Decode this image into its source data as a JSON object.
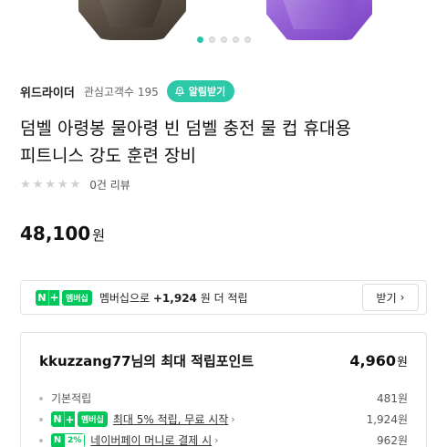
{
  "carousel": {
    "slide_count": 5,
    "active_index": 0
  },
  "seller": {
    "name": "위드라이더",
    "fans_label": "관심고객수 195",
    "alarm_button": "알림받기"
  },
  "product": {
    "title_line1": "덤벨 아령봉 물아령 빈 덤벨 충전 물 컵 휴대용",
    "title_line2": "피트니스 강도 훈련 장비",
    "rating_stars": 0,
    "review_count": "0건 리뷰",
    "price": "48,100",
    "price_unit": "원"
  },
  "membership": {
    "badge_n": "N",
    "badge_plus": "+",
    "badge_label": "멤버십",
    "text_prefix": "멤버십으로",
    "amount": "+1,924",
    "text_suffix": "원 더 적립",
    "receive_button": "받기"
  },
  "points": {
    "title": "kkuzzang77님의 최대 적립포인트",
    "total": "4,960",
    "total_unit": "원",
    "rows": [
      {
        "label": "기본적립",
        "value": "481원"
      },
      {
        "label": "최대 5% 적립, 무료 시작",
        "value": "1,924원",
        "badge": "멤버십"
      },
      {
        "label": "네이버페이 머니로 결제 시",
        "value": "962원",
        "badge": "2%"
      }
    ]
  },
  "colors": {
    "accent": "#2dc8a8",
    "naver_green": "#03c75a"
  },
  "icons": {
    "alarm": "bell-plus-icon",
    "chevron": "chevron-right-icon",
    "star": "star-icon"
  }
}
